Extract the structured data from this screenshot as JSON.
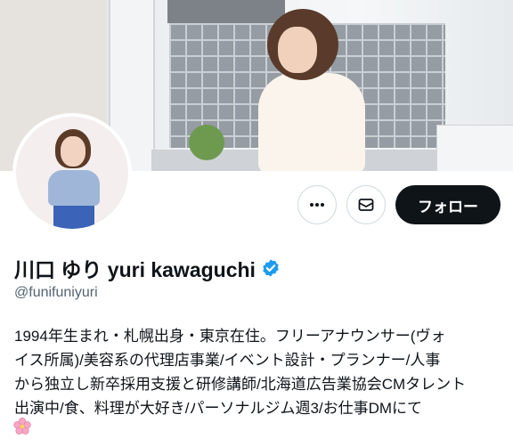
{
  "profile": {
    "display_name": "川口 ゆり yuri kawaguchi",
    "handle": "@funifuniyuri",
    "verified": true,
    "bio_lines": [
      "1994年生まれ・札幌出身・東京在住。フリーアナウンサー(ヴォ",
      "イス所属)/美容系の代理店事業/イベント設計・プランナー/人事",
      "から独立し新卒採用支援と研修講師/北海道広告業協会CMタレント",
      "出演中/食、料理が大好き/パーソナルジム週3/お仕事DMにて"
    ],
    "bio_emoji": "cherry-blossom-icon"
  },
  "actions": {
    "follow_label": "フォロー",
    "more_icon": "more-horizontal-icon",
    "message_icon": "envelope-icon"
  },
  "colors": {
    "verified_blue": "#1d9bf0",
    "follow_bg": "#0f1419",
    "handle_gray": "#536471",
    "border": "#cfd9de"
  }
}
